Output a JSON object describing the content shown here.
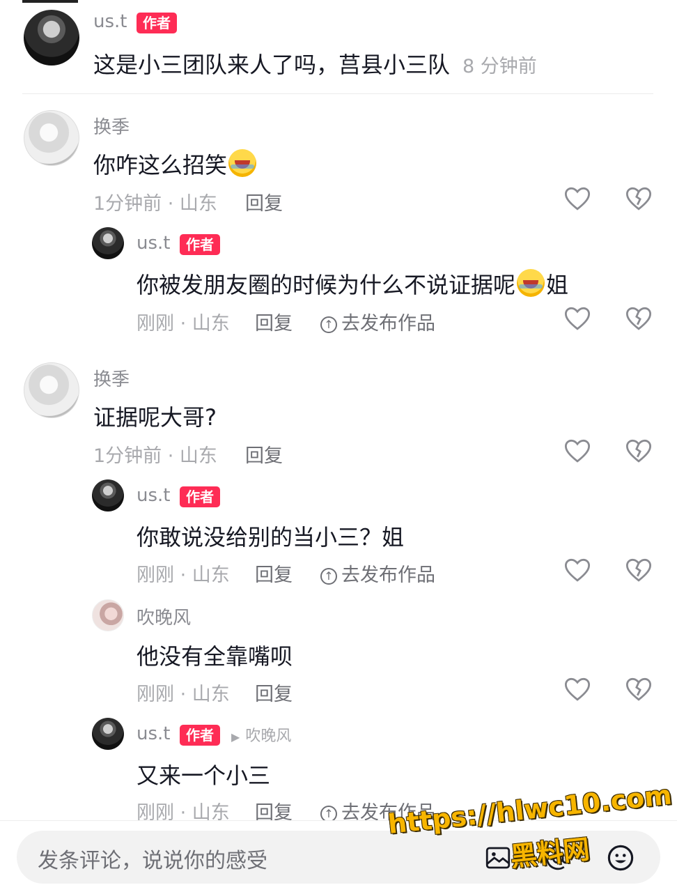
{
  "top_comment": {
    "username": "us.t",
    "badge": "作者",
    "text": "这是小三团队来人了吗，莒县小三队",
    "time": "8 分钟前"
  },
  "comments": [
    {
      "username": "换季",
      "text": "你咋这么招笑",
      "emoji": "crying-laughing-emoji",
      "meta": "1分钟前 · 山东",
      "reply_label": "回复"
    },
    {
      "username": "us.t",
      "badge": "作者",
      "text_before": "你被发朋友圈的时候为什么不说证据呢",
      "emoji": "crying-emoji",
      "text_after": "姐",
      "meta": "刚刚 · 山东",
      "reply_label": "回复",
      "publish_label": "去发布作品"
    },
    {
      "username": "换季",
      "text": "证据呢大哥?",
      "meta": "1分钟前 · 山东",
      "reply_label": "回复"
    },
    {
      "username": "us.t",
      "badge": "作者",
      "text": "你敢说没给别的当小三？姐",
      "meta": "刚刚 · 山东",
      "reply_label": "回复",
      "publish_label": "去发布作品"
    },
    {
      "username": "吹晚风",
      "text": "他没有全靠嘴呗",
      "meta": "刚刚 · 山东",
      "reply_label": "回复"
    },
    {
      "username": "us.t",
      "badge": "作者",
      "reply_to": "吹晚风",
      "text": "又来一个小三",
      "meta": "刚刚 · 山东",
      "reply_label": "回复",
      "publish_label": "去发布作品"
    }
  ],
  "input_bar": {
    "placeholder": "发条评论，说说你的感受",
    "icons": [
      "image-icon",
      "at-icon",
      "emoji-icon"
    ]
  },
  "watermark": {
    "url": "https://hlwc10.com",
    "label": "黑料网"
  },
  "colors": {
    "badge": "#fe2c55",
    "watermark": "#f7b500",
    "muted": "#a8a9ad"
  }
}
